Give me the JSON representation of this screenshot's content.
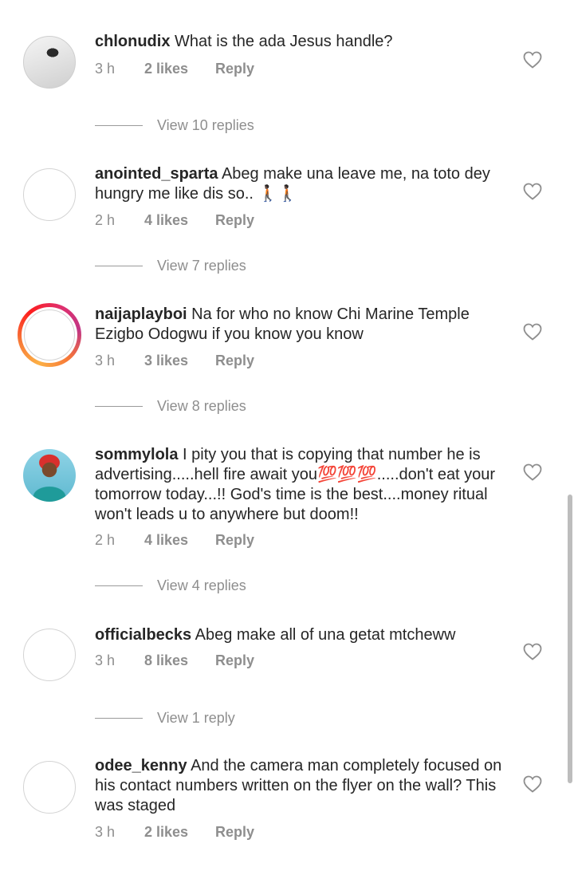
{
  "comments": [
    {
      "username": "chlonudix",
      "text": "What is the ada Jesus handle?",
      "time": "3 h",
      "likes": "2 likes",
      "reply": "Reply",
      "view_replies": "View 10 replies"
    },
    {
      "username": "anointed_sparta",
      "text": "Abeg make una leave me, na toto dey hungry me like dis so.. 🚶🏿🚶🏿",
      "time": "2 h",
      "likes": "4 likes",
      "reply": "Reply",
      "view_replies": "View 7 replies"
    },
    {
      "username": "naijaplayboi",
      "text": "Na for who no know Chi Marine Temple Ezigbo Odogwu if you know you know",
      "time": "3 h",
      "likes": "3 likes",
      "reply": "Reply",
      "view_replies": "View 8 replies"
    },
    {
      "username": "sommylola",
      "text": "I pity you that is copying that number he is advertising.....hell fire await you💯💯💯.....don't eat your tomorrow today...!! God's time is the best....money ritual won't leads u to anywhere but doom!!",
      "time": "2 h",
      "likes": "4 likes",
      "reply": "Reply",
      "view_replies": "View 4 replies"
    },
    {
      "username": "officialbecks",
      "text": "Abeg make all of una getat mtcheww",
      "time": "3 h",
      "likes": "8 likes",
      "reply": "Reply",
      "view_replies": "View 1 reply"
    },
    {
      "username": "odee_kenny",
      "text": "And the camera man completely focused on his contact numbers written on the flyer on the wall? This was staged",
      "time": "3 h",
      "likes": "2 likes",
      "reply": "Reply"
    }
  ],
  "icons": {
    "like": "heart-outline-icon"
  },
  "colors": {
    "text": "#262626",
    "meta": "#8e8e8e",
    "story_ring_start": "#fcb045",
    "story_ring_end": "#e1306c"
  }
}
